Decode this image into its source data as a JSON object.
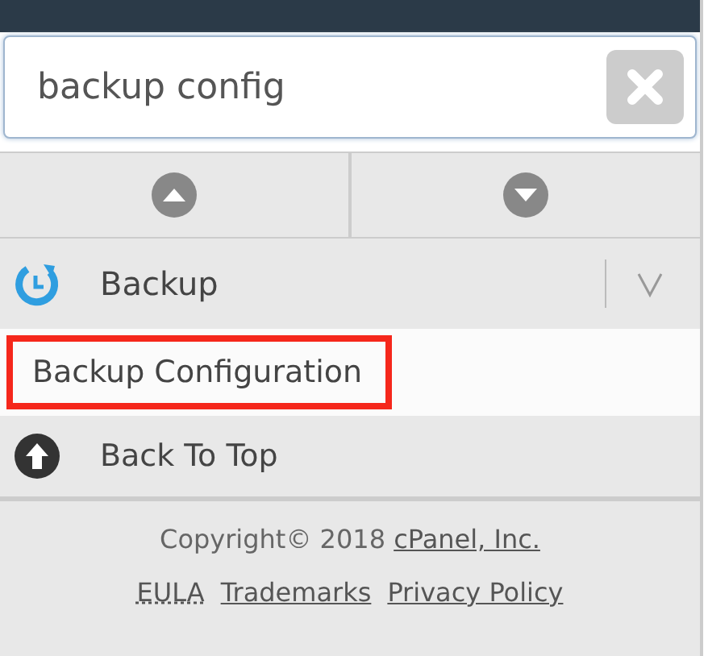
{
  "search": {
    "value": "backup config"
  },
  "section": {
    "label": "Backup",
    "expanded": true
  },
  "results": [
    {
      "label": "Backup Configuration",
      "highlighted": true
    }
  ],
  "back_to_top": {
    "label": "Back To Top"
  },
  "footer": {
    "copyright": "Copyright© 2018 ",
    "company_link": "cPanel, Inc.",
    "links": [
      {
        "label": "EULA",
        "kind": "dotted"
      },
      {
        "label": "Trademarks",
        "kind": "plain"
      },
      {
        "label": "Privacy Policy",
        "kind": "plain"
      }
    ]
  }
}
